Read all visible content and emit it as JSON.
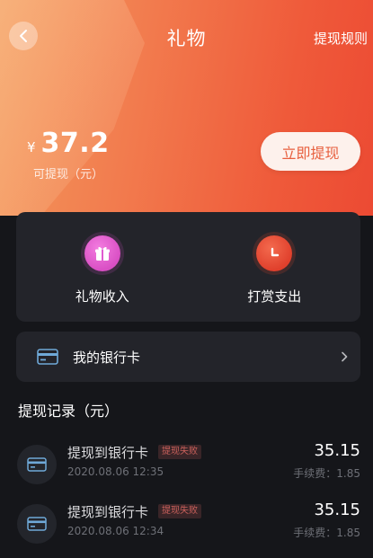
{
  "header": {
    "title": "礼物",
    "rules_link": "提现规则"
  },
  "balance": {
    "currency": "¥",
    "amount": "37.2",
    "label": "可提现（元）",
    "withdraw_button": "立即提现"
  },
  "features": [
    {
      "label": "礼物收入",
      "icon": "gift-icon",
      "color": "#e05bd0"
    },
    {
      "label": "打赏支出",
      "icon": "clock-icon",
      "color": "#e8482f"
    }
  ],
  "bank_card": {
    "label": "我的银行卡"
  },
  "records": {
    "title": "提现记录（元）",
    "items": [
      {
        "title": "提现到银行卡",
        "badge": "提现失败",
        "time": "2020.08.06 12:35",
        "amount": "35.15",
        "fee": "手续费：1.85"
      },
      {
        "title": "提现到银行卡",
        "badge": "提现失败",
        "time": "2020.08.06 12:34",
        "amount": "35.15",
        "fee": "手续费：1.85"
      }
    ]
  },
  "colors": {
    "accent": "#ef5a3a",
    "background": "#15161a",
    "card": "#23242a",
    "badge_text": "#c9605b"
  }
}
